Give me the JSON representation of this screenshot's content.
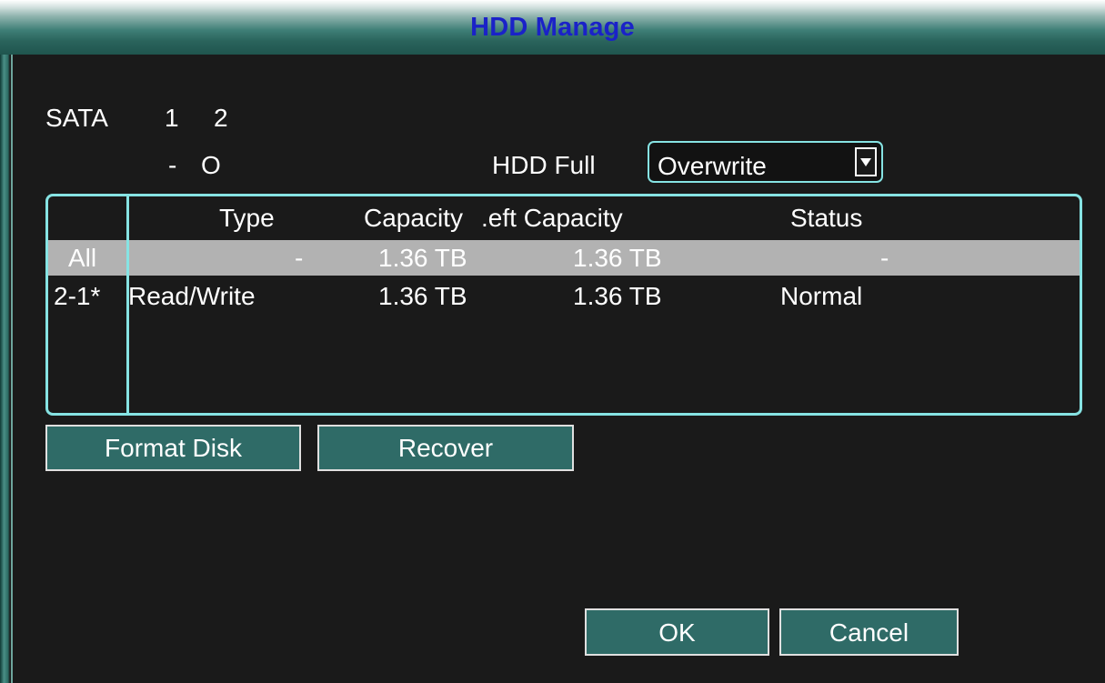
{
  "window": {
    "title": "HDD Manage"
  },
  "sata": {
    "label": "SATA",
    "channels": [
      "1",
      "2"
    ],
    "states": [
      "-",
      "O"
    ]
  },
  "hdd_full": {
    "label": "HDD Full",
    "selected": "Overwrite"
  },
  "table": {
    "headers": [
      "",
      "Type",
      "Capacity",
      ".eft Capacity",
      "Status"
    ],
    "rows": [
      {
        "id": "All",
        "type": "-",
        "capacity": "1.36 TB",
        "left_capacity": "1.36 TB",
        "status": "-",
        "selected": true
      },
      {
        "id": "2-1*",
        "type": "Read/Write",
        "capacity": "1.36 TB",
        "left_capacity": "1.36 TB",
        "status": "Normal",
        "selected": false
      }
    ]
  },
  "buttons": {
    "format": "Format Disk",
    "recover": "Recover",
    "ok": "OK",
    "cancel": "Cancel"
  },
  "colors": {
    "title_text": "#1a22c8",
    "title_bar": "#2a645c",
    "background": "#1a1a1a",
    "border_accent": "#86e3e3",
    "button_fill": "#2f6b67",
    "selected_row": "#b2b2b2"
  }
}
